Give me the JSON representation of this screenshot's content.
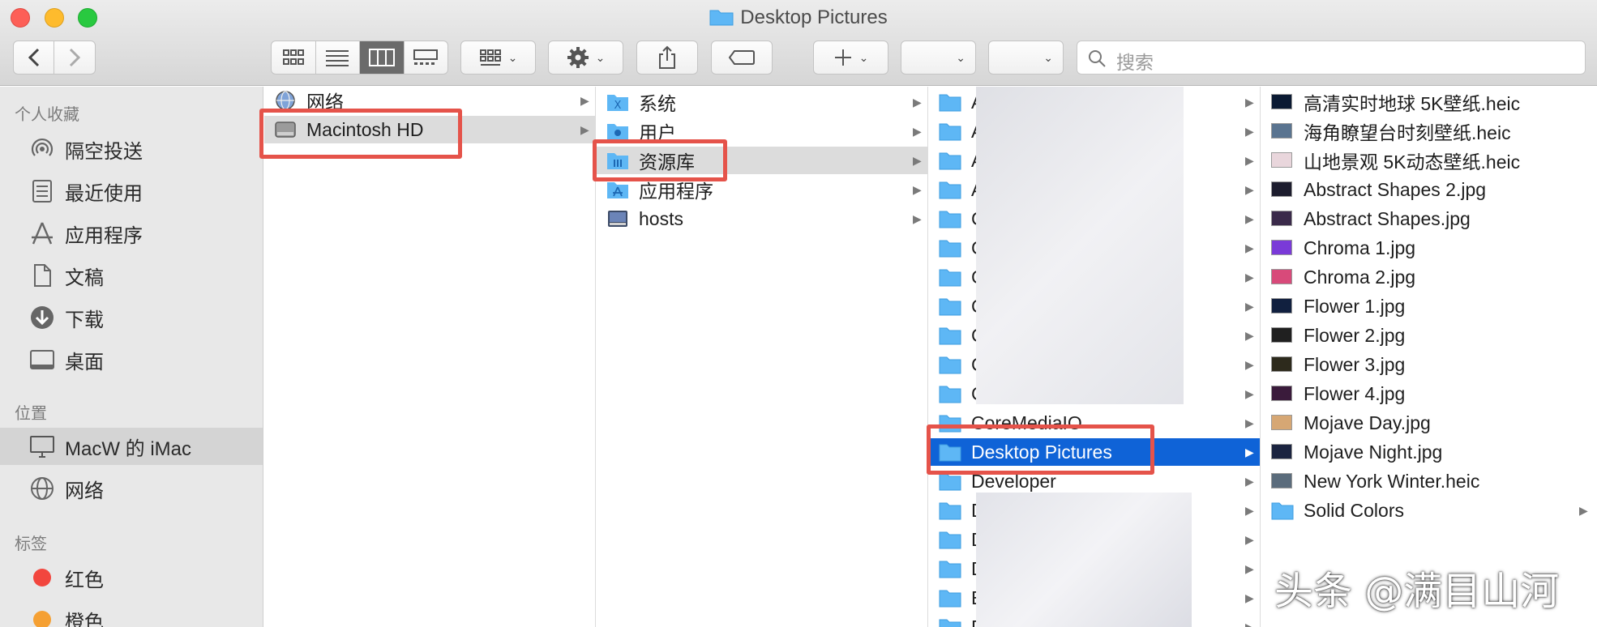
{
  "window": {
    "title": "Desktop Pictures"
  },
  "toolbar": {
    "search_placeholder": "搜索"
  },
  "sidebar": {
    "sections": [
      {
        "heading": "个人收藏",
        "items": [
          "隔空投送",
          "最近使用",
          "应用程序",
          "文稿",
          "下载",
          "桌面"
        ]
      },
      {
        "heading": "位置",
        "items": [
          "MacW 的 iMac",
          "网络"
        ]
      },
      {
        "heading": "标签",
        "items": [
          "红色",
          "橙色"
        ]
      }
    ],
    "tag_colors": [
      "#f2463e",
      "#f5a033"
    ]
  },
  "columns": {
    "col1": [
      "网络",
      "Macintosh HD"
    ],
    "col2": [
      "系统",
      "用户",
      "资源库",
      "应用程序",
      "hosts"
    ],
    "col3": [
      "A",
      "A",
      "A",
      "A",
      "C",
      "C",
      "C",
      "C",
      "C",
      "C",
      "C",
      "CoreMediaIO",
      "Desktop Pictures",
      "Developer",
      "D",
      "D",
      "D",
      "E",
      "D"
    ],
    "col4": [
      "高清实时地球 5K壁纸.heic",
      "海角瞭望台时刻壁纸.heic",
      "山地景观 5K动态壁纸.heic",
      "Abstract Shapes 2.jpg",
      "Abstract Shapes.jpg",
      "Chroma 1.jpg",
      "Chroma 2.jpg",
      "Flower 1.jpg",
      "Flower 2.jpg",
      "Flower 3.jpg",
      "Flower 4.jpg",
      "Mojave Day.jpg",
      "Mojave Night.jpg",
      "New York Winter.heic",
      "Solid Colors"
    ]
  },
  "colors": {
    "selection_blue": "#0f63d7",
    "highlight_red": "#e5534a",
    "folder_blue": "#5eb7f5"
  },
  "watermark": "头条 @满目山河"
}
